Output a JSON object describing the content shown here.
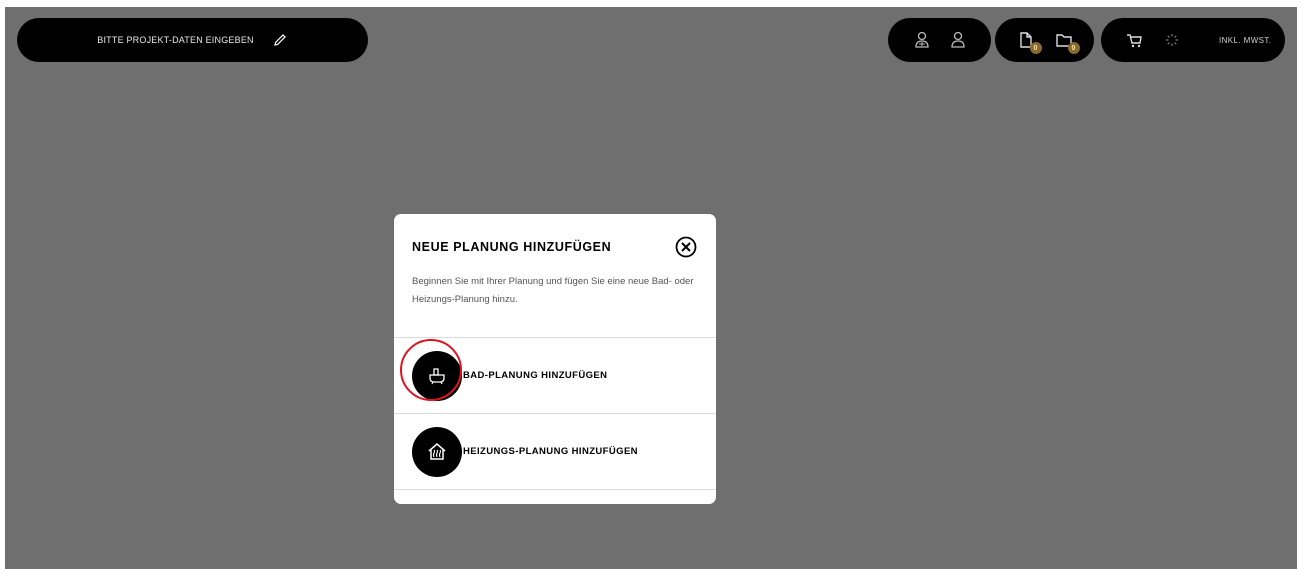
{
  "header": {
    "project_label": "BITTE PROJEKT-DATEN EINGEBEN",
    "edit_icon": "pencil-icon",
    "user_icons": [
      "user-add-icon",
      "user-icon"
    ],
    "doc_badges": [
      "0",
      "0"
    ],
    "cart_icon": "cart-icon",
    "spinner_icon": "loading-spinner-icon",
    "mwst_label": "INKL. MWST."
  },
  "modal": {
    "title": "NEUE PLANUNG HINZUFÜGEN",
    "description": "Beginnen Sie mit Ihrer Planung und fügen Sie eine neue Bad- oder Heizungs-Planung hinzu.",
    "options": [
      {
        "label": "BAD-PLANUNG HINZUFÜGEN",
        "icon": "bathtub-icon"
      },
      {
        "label": "HEIZUNGS-PLANUNG HINZUFÜGEN",
        "icon": "house-heating-icon"
      }
    ]
  },
  "colors": {
    "overlay": "#6f6f6f",
    "pill": "#000000",
    "badge": "#8a6a2c",
    "highlight": "#e0141e"
  }
}
